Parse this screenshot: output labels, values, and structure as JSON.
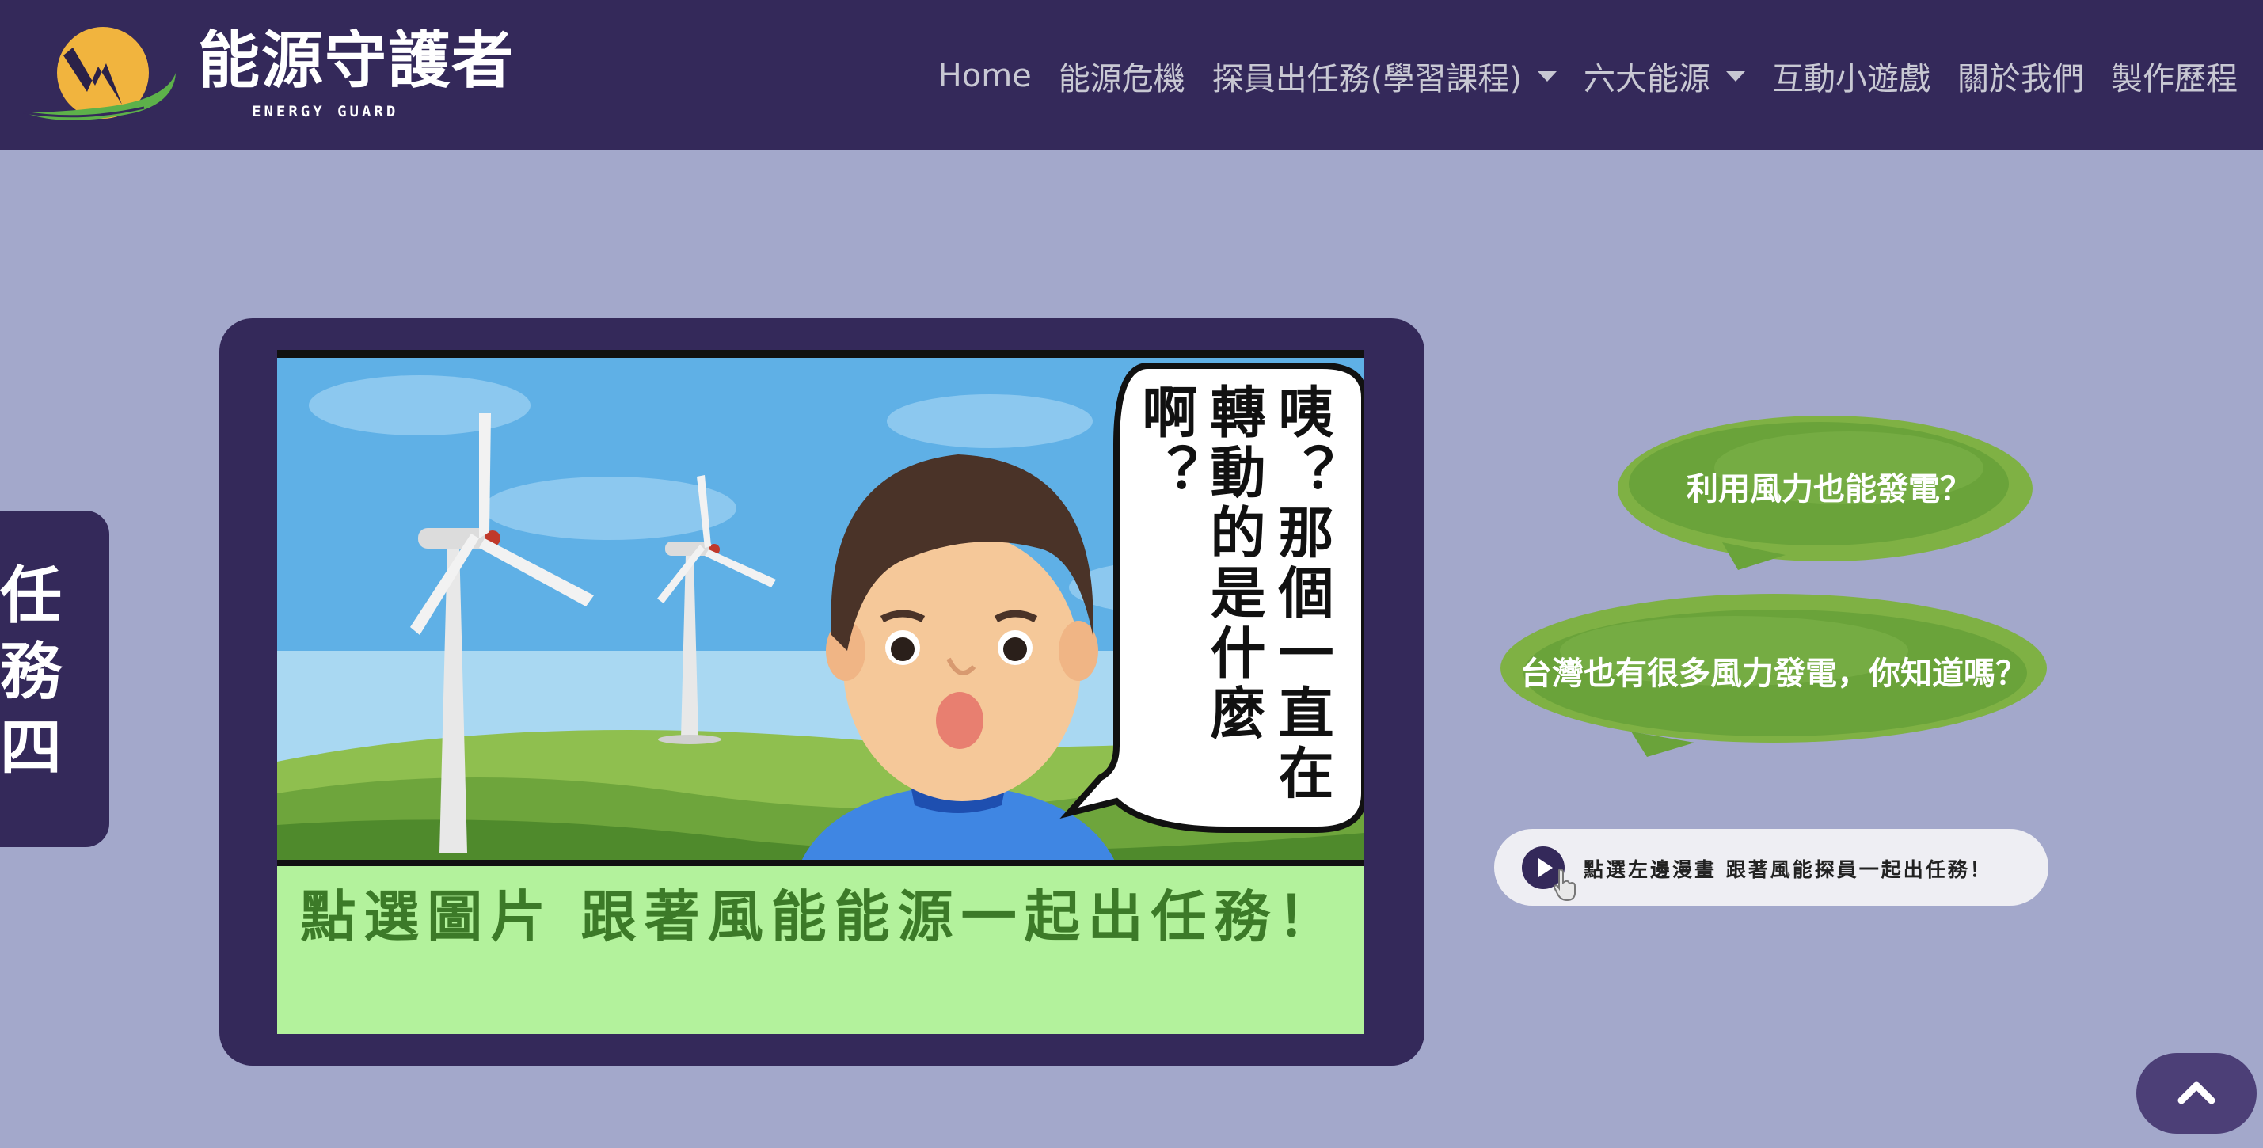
{
  "brand": {
    "name": "能源守護者",
    "subtitle": "ENERGY GUARD"
  },
  "nav": {
    "items": [
      {
        "label": "Home",
        "dropdown": false
      },
      {
        "label": "能源危機",
        "dropdown": false
      },
      {
        "label": "探員出任務(學習課程)",
        "dropdown": true
      },
      {
        "label": "六大能源",
        "dropdown": true
      },
      {
        "label": "互動小遊戲",
        "dropdown": false
      },
      {
        "label": "關於我們",
        "dropdown": false
      },
      {
        "label": "製作歷程",
        "dropdown": false
      }
    ]
  },
  "mission_tab": {
    "label": "任務四"
  },
  "comic": {
    "speech": "咦？那個一直在轉動的是什麼啊？",
    "caption": "點選圖片 跟著風能能源一起出任務！"
  },
  "bubbles": [
    {
      "text": "利用風力也能發電？"
    },
    {
      "text": "台灣也有很多風力發電，你知道嗎？"
    }
  ],
  "hint": {
    "text": "點選左邊漫畫  跟著風能探員一起出任務！",
    "icon": "play-icon"
  },
  "colors": {
    "navbar": "#34295a",
    "background": "#a3a8cb",
    "bubble_green": "#6aa33a",
    "caption_bg": "#b3f29c",
    "caption_text": "#3c7a28"
  }
}
